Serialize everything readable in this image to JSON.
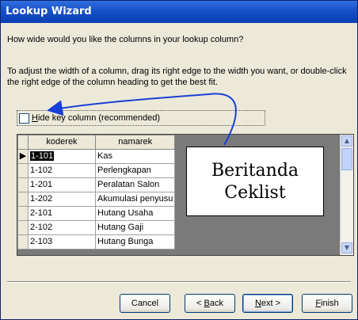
{
  "window": {
    "title": "Lookup Wizard"
  },
  "prompt": "How wide would you like the columns in your lookup column?",
  "instructions": "To adjust the width of a column, drag its right edge to the width you want, or double-click the right edge of the column heading to get the best fit.",
  "checkbox": {
    "label_hot": "H",
    "label_rest": "ide key column (recommended)",
    "checked": false
  },
  "grid": {
    "columns": [
      "koderek",
      "namarek"
    ],
    "rows": [
      [
        "1-101",
        "Kas"
      ],
      [
        "1-102",
        "Perlengkapan"
      ],
      [
        "1-201",
        "Peralatan Salon"
      ],
      [
        "1-202",
        "Akumulasi penyusu"
      ],
      [
        "2-101",
        "Hutang Usaha"
      ],
      [
        "2-102",
        "Hutang Gaji"
      ],
      [
        "2-103",
        "Hutang Bunga"
      ]
    ]
  },
  "callout": {
    "line1": "Beritanda",
    "line2": "Ceklist"
  },
  "buttons": {
    "cancel": "Cancel",
    "back_hot": "B",
    "back_rest": "ack",
    "back_prefix": "< ",
    "next_hot": "N",
    "next_rest": "ext >",
    "finish_hot": "F",
    "finish_rest": "inish"
  },
  "colors": {
    "titlebar": "#1650C7",
    "dialog_bg": "#ECE9D8",
    "arrow": "#1A3FD6"
  }
}
